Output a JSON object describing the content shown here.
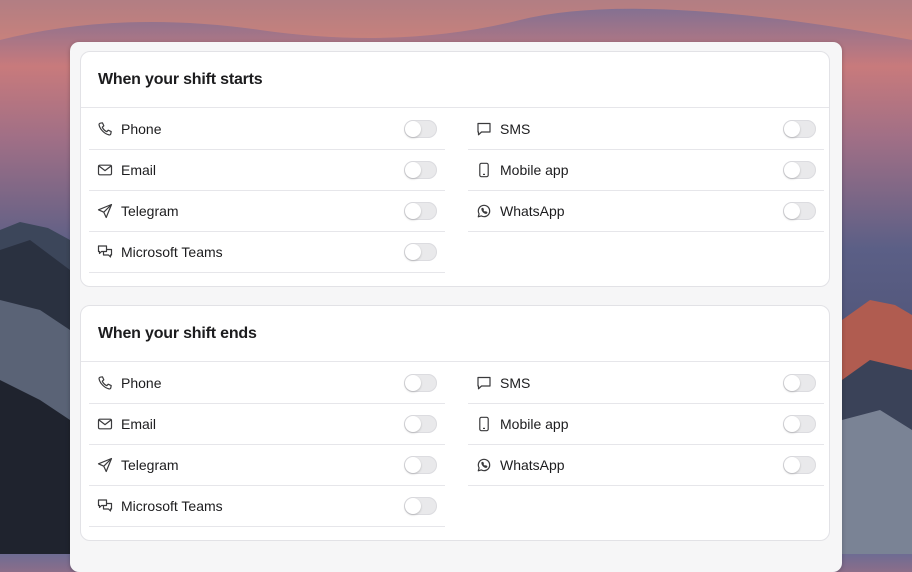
{
  "sections": [
    {
      "title": "When your shift starts",
      "left": [
        {
          "label": "Phone",
          "icon": "phone-icon",
          "enabled": false
        },
        {
          "label": "Email",
          "icon": "mail-icon",
          "enabled": false
        },
        {
          "label": "Telegram",
          "icon": "send-icon",
          "enabled": false
        },
        {
          "label": "Microsoft Teams",
          "icon": "chat-bubbles-icon",
          "enabled": false
        }
      ],
      "right": [
        {
          "label": "SMS",
          "icon": "message-icon",
          "enabled": false
        },
        {
          "label": "Mobile app",
          "icon": "smartphone-icon",
          "enabled": false
        },
        {
          "label": "WhatsApp",
          "icon": "whatsapp-icon",
          "enabled": false
        }
      ]
    },
    {
      "title": "When your shift ends",
      "left": [
        {
          "label": "Phone",
          "icon": "phone-icon",
          "enabled": false
        },
        {
          "label": "Email",
          "icon": "mail-icon",
          "enabled": false
        },
        {
          "label": "Telegram",
          "icon": "send-icon",
          "enabled": false
        },
        {
          "label": "Microsoft Teams",
          "icon": "chat-bubbles-icon",
          "enabled": false
        }
      ],
      "right": [
        {
          "label": "SMS",
          "icon": "message-icon",
          "enabled": false
        },
        {
          "label": "Mobile app",
          "icon": "smartphone-icon",
          "enabled": false
        },
        {
          "label": "WhatsApp",
          "icon": "whatsapp-icon",
          "enabled": false
        }
      ]
    }
  ],
  "colors": {
    "toggle_off": "#e9e9eb",
    "text": "#1c1c1e",
    "divider": "#e6e6ea"
  }
}
